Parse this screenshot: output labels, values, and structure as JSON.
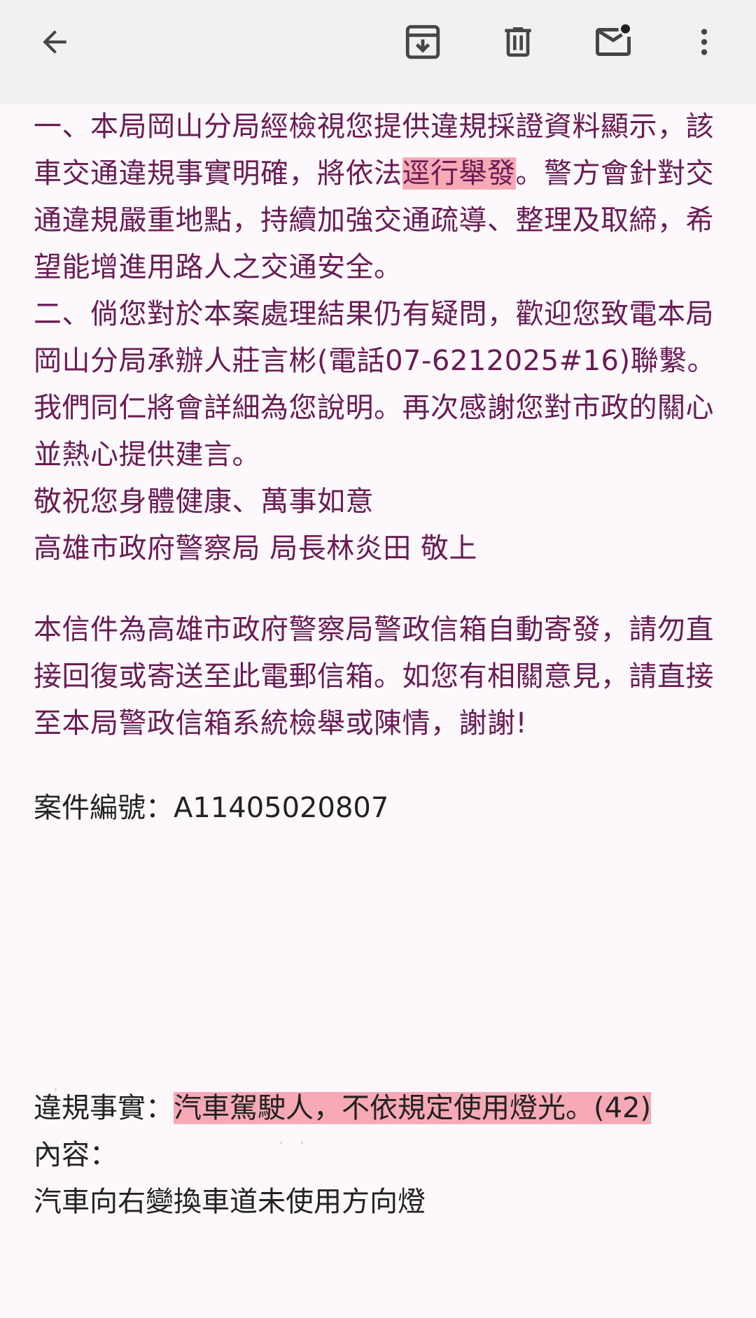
{
  "toolbar": {
    "back_icon": "arrow-left-icon",
    "archive_icon": "archive-icon",
    "delete_icon": "trash-icon",
    "mark_unread_icon": "mail-unread-icon",
    "more_icon": "more-vert-icon"
  },
  "email": {
    "para1_before": "一、本局岡山分局經檢視您提供違規採證資料顯示，該車交通違規事實明確，將依法",
    "para1_highlight": "逕行舉發",
    "para1_after": "。警方會針對交通違規嚴重地點，持續加強交通疏導、整理及取締，希望能增進用路人之交通安全。",
    "para2": "二、倘您對於本案處理結果仍有疑問，歡迎您致電本局岡山分局承辦人莊言彬(電話07-6212025#16)聯繫。",
    "para3": "我們同仁將會詳細為您說明。再次感謝您對市政的關心並熱心提供建言。",
    "closing": "敬祝您身體健康、萬事如意",
    "signature": "高雄市政府警察局 局長林炎田 敬上",
    "notice": "本信件為高雄市政府警察局警政信箱自動寄發，請勿直接回復或寄送至此電郵信箱。如您有相關意見，請直接至本局警政信箱系統檢舉或陳情，謝謝!",
    "case_label": "案件編號：",
    "case_number": "A11405020807",
    "fact_label": "違規事實：",
    "fact_value": "汽車駕駛人，不依規定使用燈光。(42)",
    "content_label": "內容：",
    "content_value": "汽車向右變換車道未使用方向燈"
  },
  "colors": {
    "body_text": "#6a1b54",
    "highlight": "#f7a9b5",
    "appbar": "#f1f0f3",
    "background": "#fcf8fc"
  }
}
